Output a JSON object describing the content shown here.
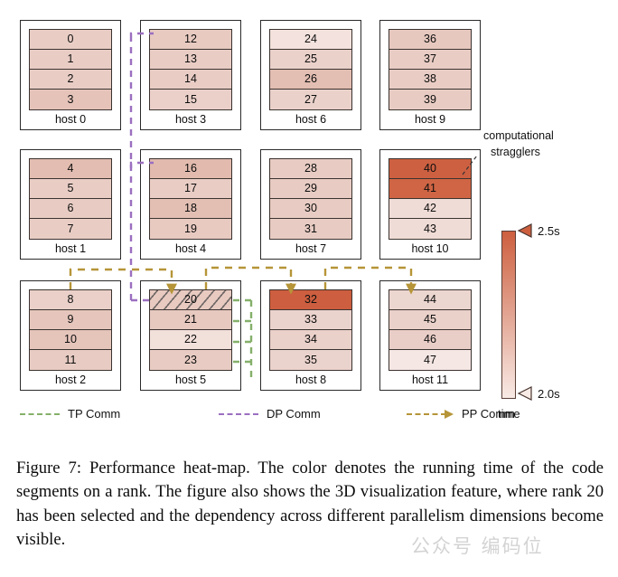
{
  "figure": {
    "caption": "Figure 7: Performance heat-map. The color denotes the running time of the code segments on a rank. The figure also shows the 3D visualization feature, where rank 20 has been selected and the dependency across different parallelism dimensions become visible.",
    "watermark": "公众号 编码位"
  },
  "annotations": {
    "stragglers_line1": "computational",
    "stragglers_line2": "stragglers"
  },
  "colors": {
    "tp_comm": "#85b06a",
    "dp_comm": "#9b6fc0",
    "pp_comm": "#b69538",
    "cell_border": "#3b3330",
    "box_border": "#2b2b2b",
    "scale_low": "#f6e2dc",
    "scale_high": "#cc5c3c"
  },
  "colorbar": {
    "top_label": "2.5s",
    "bottom_label": "2.0s",
    "axis_label": "time",
    "low_color": "#f8eae5",
    "high_color": "#cd5f3f"
  },
  "legend": {
    "items": [
      {
        "label": "TP Comm",
        "color": "#85b06a",
        "arrow": false
      },
      {
        "label": "DP Comm",
        "color": "#9b6fc0",
        "arrow": false
      },
      {
        "label": "PP Comm",
        "color": "#b69538",
        "arrow": true
      }
    ]
  },
  "chart_data": {
    "type": "heatmap",
    "title": "Performance heat-map",
    "value_unit": "s",
    "colorbar_range": [
      2.0,
      2.5
    ],
    "colorbar_label": "time",
    "grid_layout": {
      "columns": 4,
      "rows": 3,
      "ranks_per_host": 4
    },
    "selected_rank": 20,
    "stragglers": [
      40,
      41,
      32
    ],
    "hosts": [
      {
        "name": "host 0",
        "col": 0,
        "row": 0,
        "ranks": [
          {
            "rank": 0,
            "value": 2.1,
            "color": "#e9cdc5"
          },
          {
            "rank": 1,
            "value": 2.1,
            "color": "#e9cdc5"
          },
          {
            "rank": 2,
            "value": 2.1,
            "color": "#e9cdc5"
          },
          {
            "rank": 3,
            "value": 2.16,
            "color": "#e5c3b9"
          }
        ]
      },
      {
        "name": "host 3",
        "col": 1,
        "row": 0,
        "ranks": [
          {
            "rank": 12,
            "value": 2.12,
            "color": "#e8cac1"
          },
          {
            "rank": 13,
            "value": 2.11,
            "color": "#e9cdc5"
          },
          {
            "rank": 14,
            "value": 2.11,
            "color": "#e9cdc5"
          },
          {
            "rank": 15,
            "value": 2.09,
            "color": "#ead0c9"
          }
        ]
      },
      {
        "name": "host 6",
        "col": 2,
        "row": 0,
        "ranks": [
          {
            "rank": 24,
            "value": 2.03,
            "color": "#f3e2dd"
          },
          {
            "rank": 25,
            "value": 2.09,
            "color": "#ead1ca"
          },
          {
            "rank": 26,
            "value": 2.17,
            "color": "#e3beb2"
          },
          {
            "rank": 27,
            "value": 2.08,
            "color": "#ead2cb"
          }
        ]
      },
      {
        "name": "host 9",
        "col": 3,
        "row": 0,
        "ranks": [
          {
            "rank": 36,
            "value": 2.13,
            "color": "#e7c8bf"
          },
          {
            "rank": 37,
            "value": 2.1,
            "color": "#e9cdc5"
          },
          {
            "rank": 38,
            "value": 2.1,
            "color": "#e9cdc5"
          },
          {
            "rank": 39,
            "value": 2.11,
            "color": "#e8ccc3"
          }
        ]
      },
      {
        "name": "host 1",
        "col": 0,
        "row": 1,
        "ranks": [
          {
            "rank": 4,
            "value": 2.18,
            "color": "#e3bdb1"
          },
          {
            "rank": 5,
            "value": 2.1,
            "color": "#e9cdc5"
          },
          {
            "rank": 6,
            "value": 2.11,
            "color": "#e8ccc3"
          },
          {
            "rank": 7,
            "value": 2.1,
            "color": "#e9cdc5"
          }
        ]
      },
      {
        "name": "host 4",
        "col": 1,
        "row": 1,
        "ranks": [
          {
            "rank": 16,
            "value": 2.19,
            "color": "#e2bbae"
          },
          {
            "rank": 17,
            "value": 2.1,
            "color": "#e9cdc5"
          },
          {
            "rank": 18,
            "value": 2.18,
            "color": "#e3bfb3"
          },
          {
            "rank": 19,
            "value": 2.12,
            "color": "#e8cac1"
          }
        ]
      },
      {
        "name": "host 7",
        "col": 2,
        "row": 1,
        "ranks": [
          {
            "rank": 28,
            "value": 2.11,
            "color": "#e8ccc3"
          },
          {
            "rank": 29,
            "value": 2.11,
            "color": "#e8ccc3"
          },
          {
            "rank": 30,
            "value": 2.11,
            "color": "#e8ccc3"
          },
          {
            "rank": 31,
            "value": 2.11,
            "color": "#e8ccc3"
          }
        ]
      },
      {
        "name": "host 10",
        "col": 3,
        "row": 1,
        "ranks": [
          {
            "rank": 40,
            "value": 2.46,
            "color": "#cd6041"
          },
          {
            "rank": 41,
            "value": 2.44,
            "color": "#cf6544"
          },
          {
            "rank": 42,
            "value": 2.05,
            "color": "#f0dcd6"
          },
          {
            "rank": 43,
            "value": 2.05,
            "color": "#f0dcd6"
          }
        ]
      },
      {
        "name": "host 2",
        "col": 0,
        "row": 2,
        "ranks": [
          {
            "rank": 8,
            "value": 2.09,
            "color": "#ead0c9"
          },
          {
            "rank": 9,
            "value": 2.14,
            "color": "#e6c6bc"
          },
          {
            "rank": 10,
            "value": 2.15,
            "color": "#e5c4ba"
          },
          {
            "rank": 11,
            "value": 2.11,
            "color": "#e8ccc3"
          }
        ]
      },
      {
        "name": "host 5",
        "col": 1,
        "row": 2,
        "ranks": [
          {
            "rank": 20,
            "value": 2.11,
            "color": "#e8cac1",
            "selected": true
          },
          {
            "rank": 21,
            "value": 2.12,
            "color": "#e7c9c0"
          },
          {
            "rank": 22,
            "value": 2.04,
            "color": "#f2e0db"
          },
          {
            "rank": 23,
            "value": 2.11,
            "color": "#e8ccc3"
          }
        ]
      },
      {
        "name": "host 8",
        "col": 2,
        "row": 2,
        "ranks": [
          {
            "rank": 32,
            "value": 2.47,
            "color": "#cd5e3f"
          },
          {
            "rank": 33,
            "value": 2.08,
            "color": "#ebd3cd"
          },
          {
            "rank": 34,
            "value": 2.09,
            "color": "#ead1ca"
          },
          {
            "rank": 35,
            "value": 2.08,
            "color": "#ebd3cd"
          }
        ]
      },
      {
        "name": "host 11",
        "col": 3,
        "row": 2,
        "ranks": [
          {
            "rank": 44,
            "value": 2.07,
            "color": "#ecd6d0"
          },
          {
            "rank": 45,
            "value": 2.09,
            "color": "#ead1ca"
          },
          {
            "rank": 46,
            "value": 2.1,
            "color": "#e9cec7"
          },
          {
            "rank": 47,
            "value": 2.02,
            "color": "#f5e7e3"
          }
        ]
      }
    ]
  }
}
